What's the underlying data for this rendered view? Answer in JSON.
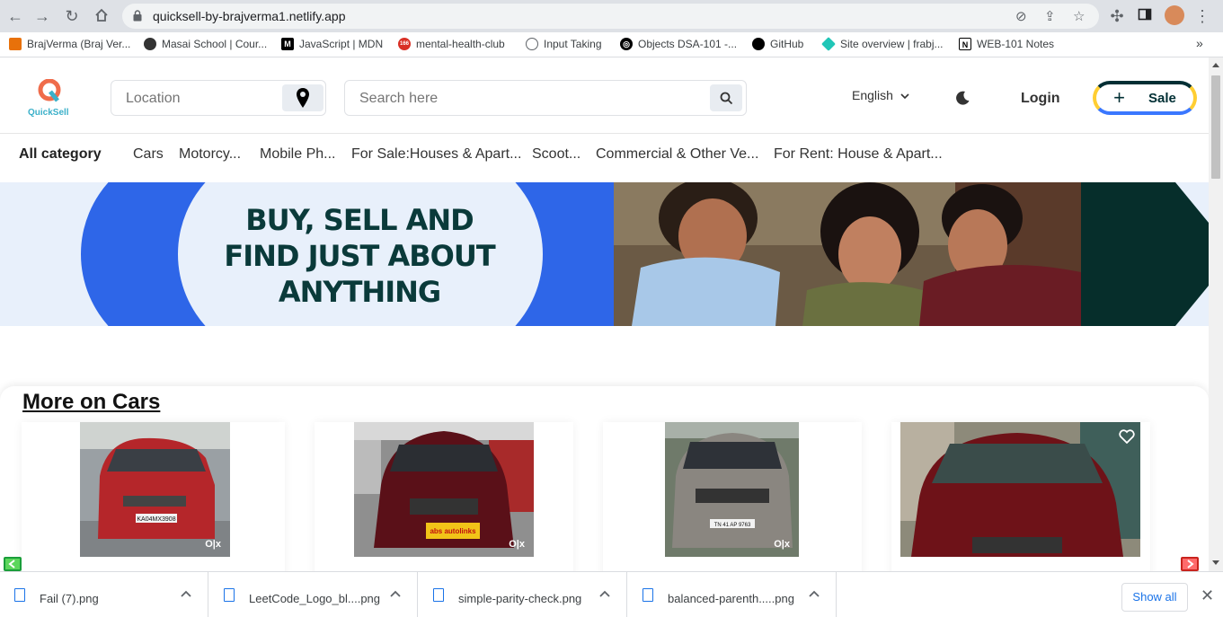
{
  "browser": {
    "url": "quicksell-by-brajverma1.netlify.app",
    "bookmarks": [
      {
        "label": "BrajVerma (Braj Ver...",
        "icon": "bitbucket-icon",
        "color": "#e8710a"
      },
      {
        "label": "Masai School | Cour...",
        "icon": "globe-icon",
        "color": "#333333"
      },
      {
        "label": "JavaScript | MDN",
        "icon": "mdn-icon",
        "color": "#000000"
      },
      {
        "label": "mental-health-club",
        "icon": "badge-166-icon",
        "color": "#d93025"
      },
      {
        "label": "Input Taking",
        "icon": "clock-icon",
        "color": "#5f6368"
      },
      {
        "label": "Objects DSA-101 -...",
        "icon": "target-icon",
        "color": "#000000"
      },
      {
        "label": "GitHub",
        "icon": "github-icon",
        "color": "#000000"
      },
      {
        "label": "Site overview | frabj...",
        "icon": "netlify-icon",
        "color": "#20c6b7"
      },
      {
        "label": "WEB-101 Notes",
        "icon": "notion-icon",
        "color": "#000000"
      }
    ],
    "more_bookmarks": "»"
  },
  "header": {
    "logo_text": "QuickSell",
    "location_placeholder": "Location",
    "search_placeholder": "Search here",
    "language": "English",
    "login_label": "Login",
    "sale_label": "Sale",
    "sale_icon": "+"
  },
  "categories": {
    "all": "All category",
    "items": [
      "Cars",
      "Motorcy...",
      "Mobile Ph...",
      "For Sale:Houses & Apart...",
      "Scoot...",
      "Commercial & Other Ve...",
      "For Rent: House & Apart..."
    ]
  },
  "banner": {
    "line1": "BUY, SELL AND",
    "line2": "FIND JUST ABOUT",
    "line3": "ANYTHING"
  },
  "section": {
    "title": "More on Cars",
    "cards": [
      {
        "car": "red-renault-kwid",
        "plate": "KA04MX3908",
        "watermark": "O|x"
      },
      {
        "car": "maroon-suzuki-ciaz",
        "plate": "abs autolinks",
        "watermark": "O|x"
      },
      {
        "car": "grey-vitara-brezza",
        "plate": "TN 41 AP 9763",
        "watermark": "O|x"
      },
      {
        "car": "maroon-suzuki-alto",
        "plate": "",
        "watermark": ""
      }
    ]
  },
  "downloads": {
    "files": [
      "Fail (7).png",
      "LeetCode_Logo_bl....png",
      "simple-parity-check.png",
      "balanced-parenth.....png"
    ],
    "show_all": "Show all"
  },
  "colors": {
    "brand_dark": "#002f34",
    "banner_blue": "#2e66e8",
    "banner_bg": "#e8f0fb",
    "link_blue": "#1a73e8"
  }
}
